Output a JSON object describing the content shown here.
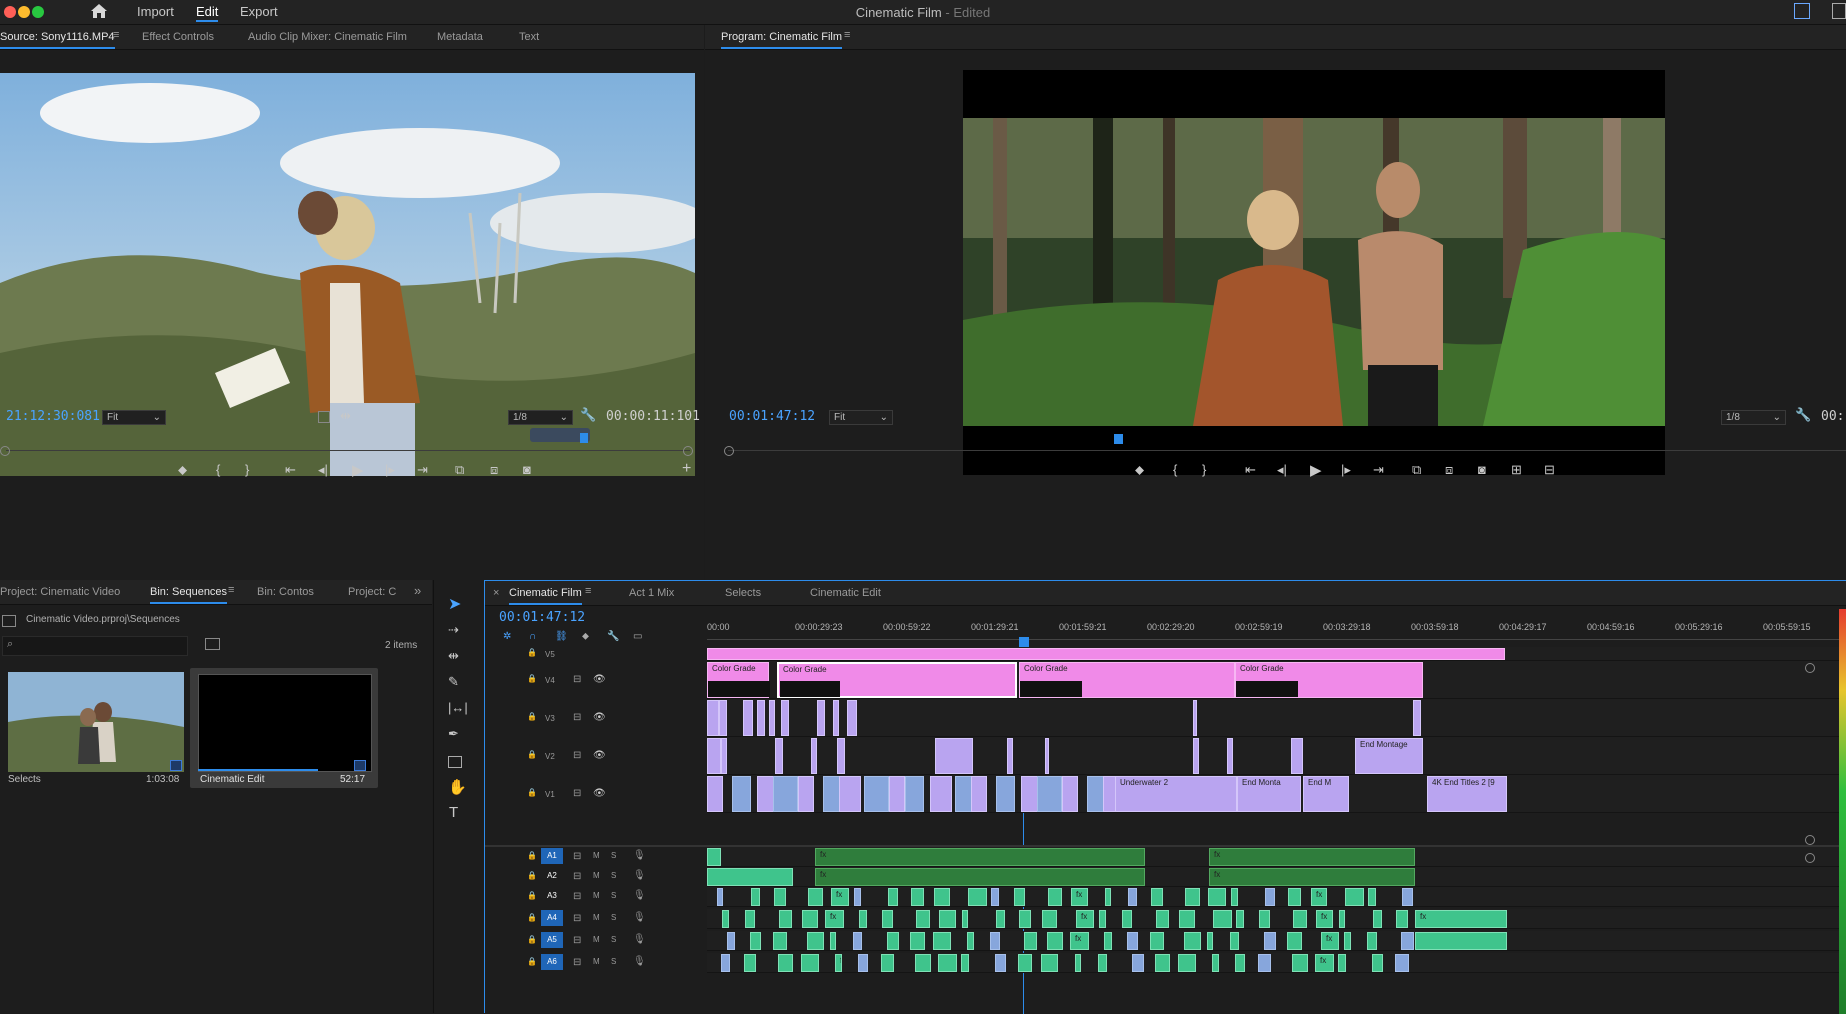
{
  "menu": {
    "import": "Import",
    "edit": "Edit",
    "export": "Export"
  },
  "app": {
    "title": "Cinematic Film",
    "status": " - Edited"
  },
  "source_panel": {
    "tabs": [
      "Source: Sony1116.MP4",
      "Effect Controls",
      "Audio Clip Mixer: Cinematic Film",
      "Metadata",
      "Text"
    ],
    "timecode": "21:12:30:081",
    "zoom": "Fit",
    "resolution": "1/8",
    "duration": "00:00:11:101"
  },
  "program_panel": {
    "tab": "Program: Cinematic Film",
    "timecode": "00:01:47:12",
    "zoom": "Fit",
    "resolution": "1/8",
    "duration_partial": "00:"
  },
  "project_panel": {
    "tabs": [
      "Project: Cinematic Video",
      "Bin: Sequences",
      "Bin: Contos",
      "Project: C"
    ],
    "path": "Cinematic Video.prproj\\Sequences",
    "item_count": "2 items",
    "items": [
      {
        "name": "Selects",
        "duration": "1:03:08"
      },
      {
        "name": "Cinematic Edit",
        "duration": "52:17"
      }
    ]
  },
  "timeline": {
    "tabs": [
      "Cinematic Film",
      "Act 1 Mix",
      "Selects",
      "Cinematic Edit"
    ],
    "timecode": "00:01:47:12",
    "ticks": [
      "00:00",
      "00:00:29:23",
      "00:00:59:22",
      "00:01:29:21",
      "00:01:59:21",
      "00:02:29:20",
      "00:02:59:19",
      "00:03:29:18",
      "00:03:59:18",
      "00:04:29:17",
      "00:04:59:16",
      "00:05:29:16",
      "00:05:59:15"
    ],
    "video_tracks": [
      "V5",
      "V4",
      "V3",
      "V2",
      "V1"
    ],
    "audio_tracks": [
      "A1",
      "A2",
      "A3",
      "A4",
      "A5",
      "A6"
    ],
    "clip_labels": {
      "color_grade": "Color Grade",
      "fx": "fx",
      "end_montage": "End Montage",
      "underwater": "Underwater 2",
      "end_monta": "End Monta",
      "end_m": "End M",
      "end_titles": "4K End Titles 2 [9"
    },
    "mute": "M",
    "solo": "S"
  },
  "colors": {
    "accent": "#2d8ceb",
    "timecode": "#4aa3ff",
    "adjustment_clip": "#f08ae8",
    "video_clip": "#b9a4f0",
    "audio_clip": "#2f7d3c",
    "audio_clip_bright": "#3fc48c"
  }
}
